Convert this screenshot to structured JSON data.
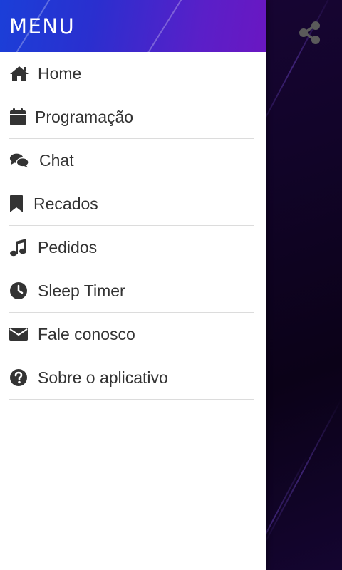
{
  "drawer": {
    "title": "MENU",
    "items": [
      {
        "label": "Home",
        "icon": "home-icon"
      },
      {
        "label": "Programação",
        "icon": "calendar-icon"
      },
      {
        "label": "Chat",
        "icon": "chat-bubbles-icon"
      },
      {
        "label": "Recados",
        "icon": "bookmark-icon"
      },
      {
        "label": "Pedidos",
        "icon": "music-note-icon"
      },
      {
        "label": "Sleep Timer",
        "icon": "clock-icon"
      },
      {
        "label": "Fale conosco",
        "icon": "envelope-icon"
      },
      {
        "label": "Sobre o aplicativo",
        "icon": "question-circle-icon"
      }
    ]
  },
  "toolbar": {
    "share_icon": "share-icon"
  },
  "colors": {
    "header_start": "#1b3fd8",
    "header_end": "#6a17c2",
    "icon": "#333333",
    "text": "#333333",
    "background": "#12042a"
  }
}
